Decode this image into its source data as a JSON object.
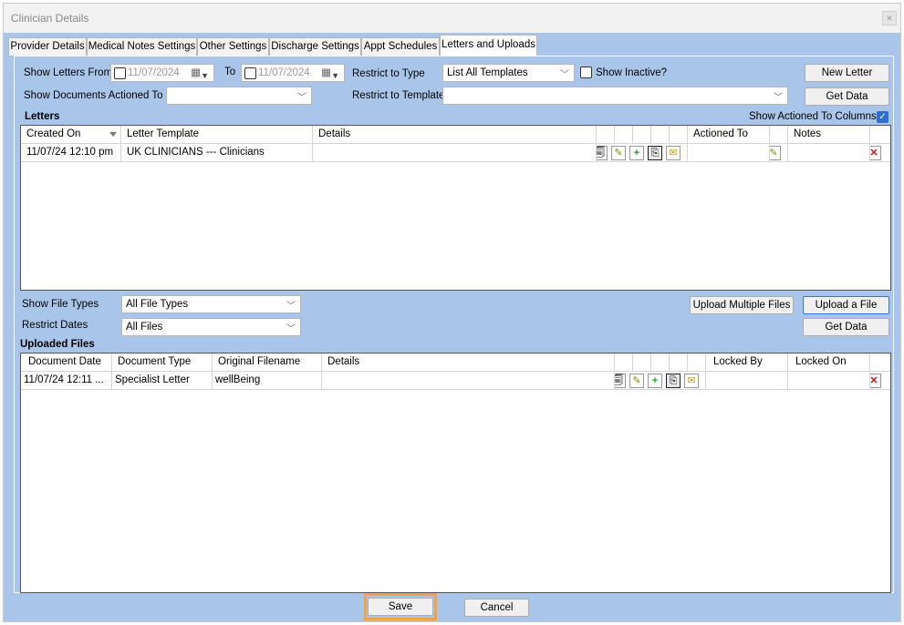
{
  "window": {
    "title": "Clinician Details",
    "close_glyph": "✕"
  },
  "tabs": [
    {
      "label": "Provider Details"
    },
    {
      "label": "Medical Notes Settings"
    },
    {
      "label": "Other Settings"
    },
    {
      "label": "Discharge Settings"
    },
    {
      "label": "Appt Schedules"
    },
    {
      "label": "Letters and Uploads",
      "active": true
    }
  ],
  "filters": {
    "show_letters_from_label": "Show Letters From",
    "from_date": "11/07/2024",
    "to_label": "To",
    "to_date": "11/07/2024",
    "restrict_type_label": "Restrict to Type",
    "restrict_type_value": "List All Templates",
    "show_inactive_label": "Show Inactive?",
    "new_letter_label": "New Letter",
    "show_docs_actioned_label": "Show Documents Actioned To",
    "show_docs_actioned_value": "",
    "restrict_template_label": "Restrict to Template",
    "restrict_template_value": "",
    "get_data_label": "Get Data"
  },
  "letters": {
    "section_label": "Letters",
    "show_actioned_label": "Show Actioned To Columns",
    "show_actioned_checked": true,
    "columns": [
      "Created On",
      "Letter Template",
      "Details",
      "Actioned To",
      "Notes"
    ],
    "rows": [
      {
        "created_on": "11/07/24 12:10 pm",
        "template": "UK CLINICIANS --- Clinicians",
        "details": "",
        "actioned_to": "",
        "notes": ""
      }
    ]
  },
  "uploads": {
    "show_file_types_label": "Show File Types",
    "file_types_value": "All File Types",
    "restrict_dates_label": "Restrict Dates",
    "restrict_dates_value": "All Files",
    "upload_multiple_label": "Upload Multiple Files",
    "upload_file_label": "Upload a File",
    "get_data_label": "Get Data",
    "section_label": "Uploaded Files",
    "columns": [
      "Document Date",
      "Document Type",
      "Original Filename",
      "Details",
      "Locked By",
      "Locked On"
    ],
    "rows": [
      {
        "document_date": "11/07/24 12:11 ...",
        "document_type": "Specialist Letter",
        "filename": "wellBeing",
        "details": "",
        "locked_by": "",
        "locked_on": ""
      }
    ]
  },
  "icons": {
    "view_glyph": "🗐",
    "edit_glyph": "✎",
    "add_glyph": "+",
    "copy_glyph": "⎘",
    "email_glyph": "✉",
    "delete_glyph": "✕",
    "calendar_glyph": "▦",
    "check_glyph": "✓"
  },
  "footer": {
    "save_label": "Save",
    "cancel_label": "Cancel"
  }
}
